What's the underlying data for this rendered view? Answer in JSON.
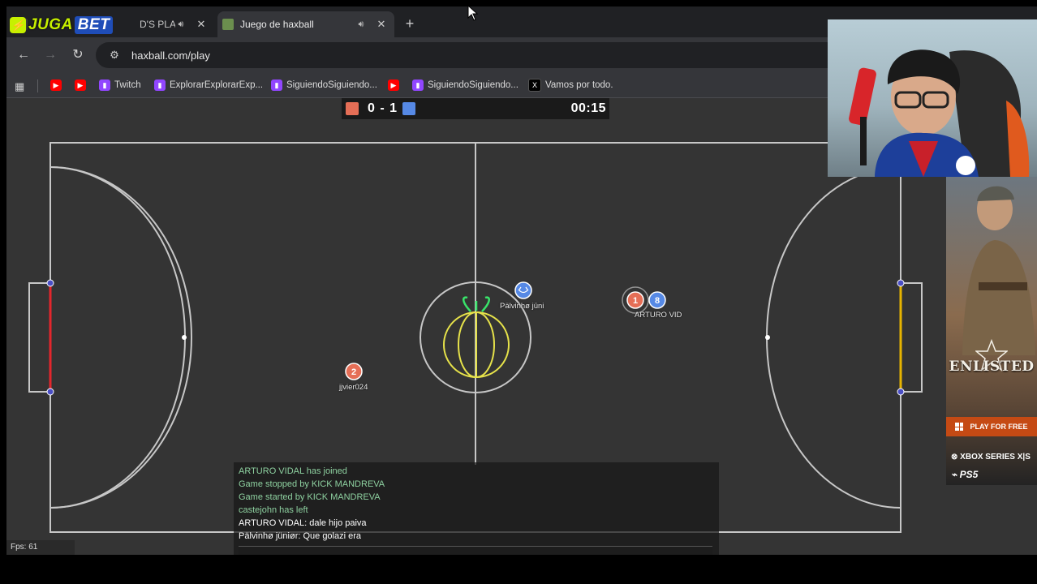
{
  "browser": {
    "tabs": [
      {
        "title": "D'S PLAN (",
        "active": false
      },
      {
        "title": "Juego de haxball",
        "active": true
      }
    ],
    "new_tab_icon": "+",
    "url": "haxball.com/play",
    "nav": {
      "back": "←",
      "forward": "→",
      "reload": "↻"
    }
  },
  "overlay_logo": {
    "juga": "JUGA",
    "bet": "BET"
  },
  "bookmarks": [
    {
      "label": "",
      "icon": "youtube-icon"
    },
    {
      "label": "",
      "icon": "youtube-icon"
    },
    {
      "label": "Twitch",
      "icon": "twitch-icon"
    },
    {
      "label": "ExplorarExplorarExp...",
      "icon": "twitch-icon"
    },
    {
      "label": "SiguiendoSiguiendo...",
      "icon": "twitch-icon"
    },
    {
      "label": "",
      "icon": "youtube-icon"
    },
    {
      "label": "SiguiendoSiguiendo...",
      "icon": "twitch-icon"
    },
    {
      "label": "Vamos por todo.",
      "icon": "x-icon"
    }
  ],
  "scoreboard": {
    "red": 0,
    "blue": 1,
    "score_text": "0 - 1",
    "time": "00:15"
  },
  "colors": {
    "red_team": "#e56e56",
    "blue_team": "#5689e5",
    "field": "#343434",
    "line": "#c7c7c7",
    "red_goal": "#e4262c",
    "yellow_goal": "#e6b400"
  },
  "players": [
    {
      "avatar": "1",
      "team": "red",
      "name": ""
    },
    {
      "avatar": "8",
      "team": "blue",
      "name": "ARTURO VID"
    },
    {
      "avatar": "2",
      "team": "red",
      "name": "jjvier024"
    },
    {
      "avatar": "~",
      "team": "blue",
      "name": "Pälvinhø jüni"
    }
  ],
  "chat": [
    {
      "text": "ARTURO VIDAL has joined",
      "type": "notice"
    },
    {
      "text": "Game stopped by KICK MANDREVA",
      "type": "notice"
    },
    {
      "text": "Game started by KICK MANDREVA",
      "type": "notice"
    },
    {
      "text": "castejohn has left",
      "type": "notice"
    },
    {
      "text": "ARTURO VIDAL: dale hijo paiva",
      "type": "msg"
    },
    {
      "text": "Pälvinhø jüniør: Que golazi era",
      "type": "msg"
    }
  ],
  "fps": "Fps: 61",
  "ad": {
    "title": "ENLISTED",
    "cta": "PLAY FOR FREE",
    "platform1": "XBOX SERIES X|S",
    "platform2": "PS5"
  }
}
